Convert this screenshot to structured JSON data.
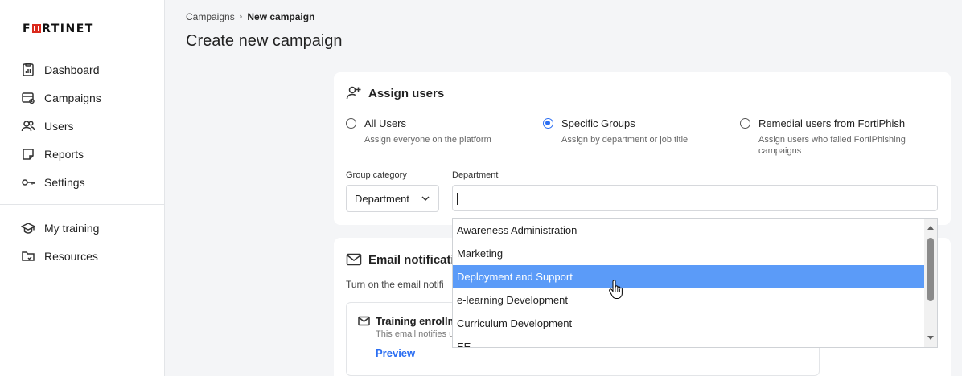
{
  "brand": {
    "logo_before": "F",
    "logo_after": "RTINET",
    "accent": "#da291c"
  },
  "sidebar": {
    "items": [
      {
        "label": "Dashboard",
        "icon": "dashboard-icon"
      },
      {
        "label": "Campaigns",
        "icon": "campaigns-icon"
      },
      {
        "label": "Users",
        "icon": "users-icon"
      },
      {
        "label": "Reports",
        "icon": "reports-icon"
      },
      {
        "label": "Settings",
        "icon": "key-icon"
      }
    ],
    "secondary_items": [
      {
        "label": "My training",
        "icon": "graduation-cap-icon"
      },
      {
        "label": "Resources",
        "icon": "folder-icon"
      }
    ]
  },
  "breadcrumb": {
    "parent": "Campaigns",
    "current": "New campaign"
  },
  "page": {
    "title": "Create new campaign"
  },
  "assign_users": {
    "title": "Assign users",
    "options": [
      {
        "label": "All Users",
        "sub": "Assign everyone on the platform",
        "checked": false
      },
      {
        "label": "Specific Groups",
        "sub": "Assign by department or job title",
        "checked": true
      },
      {
        "label": "Remedial users from FortiPhish",
        "sub": "Assign users who failed FortiPhishing campaigns",
        "checked": false
      }
    ],
    "group_category_label": "Group category",
    "group_category_value": "Department",
    "department_label": "Department",
    "department_value": ""
  },
  "email_notifications": {
    "title": "Email notificatio",
    "subtitle": "Turn on the email notifi",
    "item_title": "Training enrollm",
    "item_desc": "This email notifies u",
    "preview_label": "Preview"
  },
  "department_dropdown": {
    "options": [
      "Awareness Administration",
      "Marketing",
      "Deployment and Support",
      "e-learning Development",
      "Curriculum Development",
      "EE"
    ],
    "selected_index": 2,
    "highlight_color": "#5b9bf8"
  }
}
